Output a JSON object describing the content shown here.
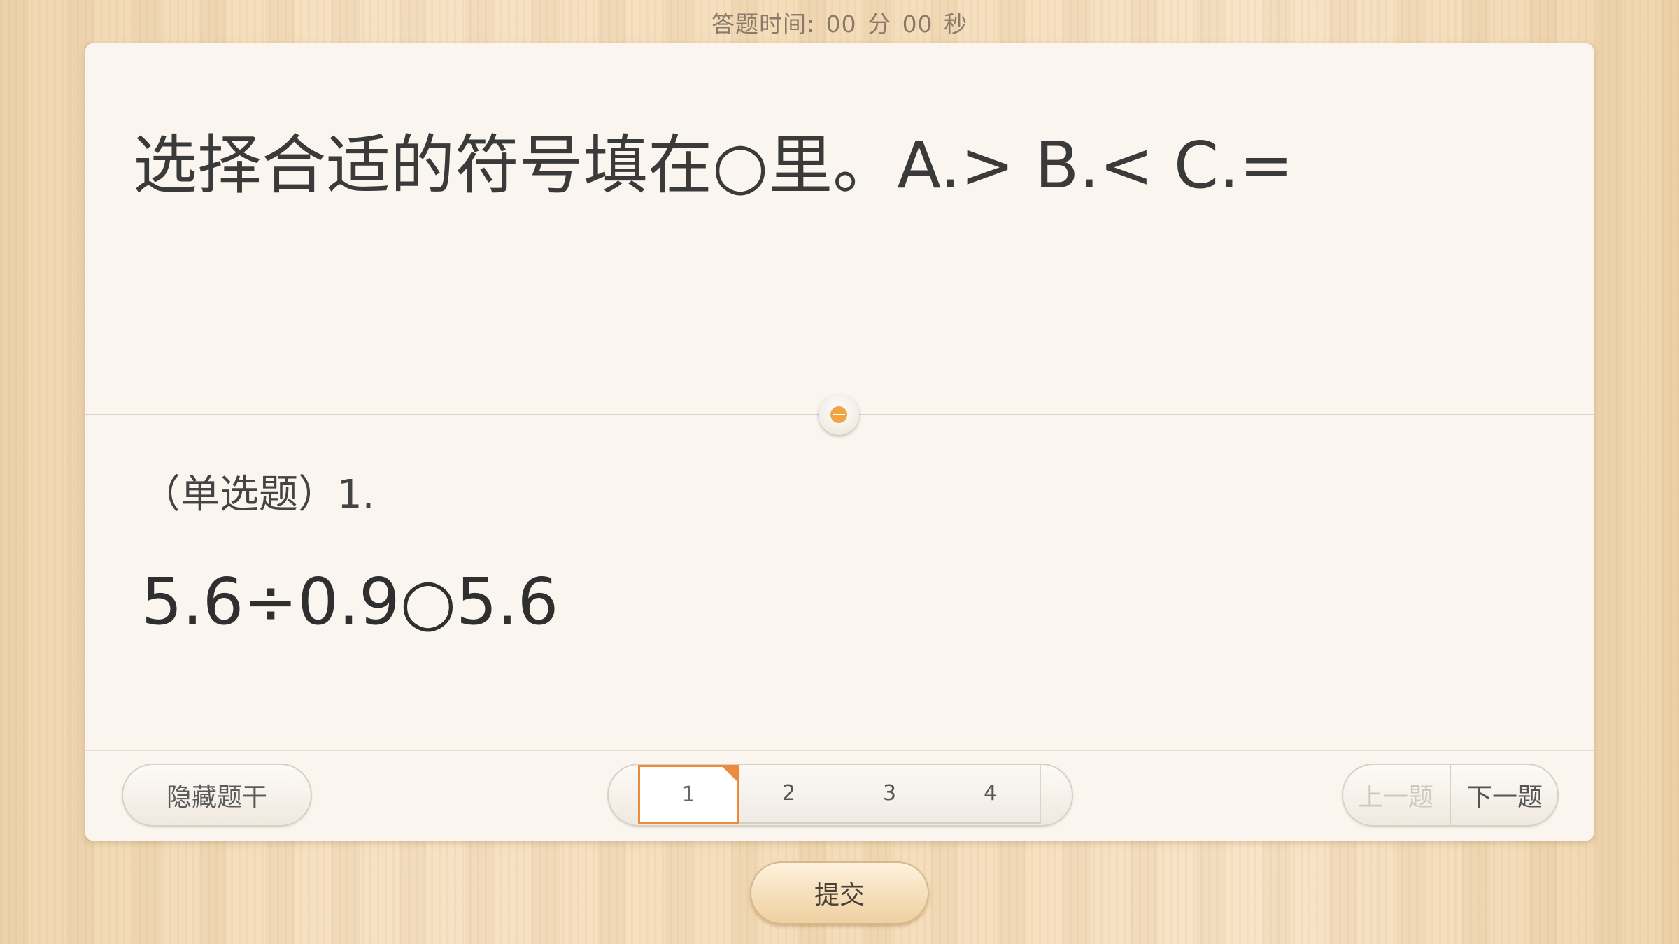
{
  "timer": {
    "label": "答题时间:",
    "minutes": "00",
    "minutes_unit": "分",
    "seconds": "00",
    "seconds_unit": "秒"
  },
  "question": {
    "stem": "选择合适的符号填在○里。A.>   B.<   C.=",
    "type_label": "（单选题）1.",
    "expression": "5.6÷0.9○5.6"
  },
  "footer": {
    "hide_label": "隐藏题干",
    "pages": [
      "1",
      "2",
      "3",
      "4"
    ],
    "active_page": "1",
    "prev_label": "上一题",
    "next_label": "下一题"
  },
  "submit_label": "提交",
  "colors": {
    "accent": "#ee8a3c",
    "card_bg": "#faf6ef",
    "text": "#3a3a3a"
  },
  "icons": {
    "divider_handle": "collapse-toggle-icon",
    "page_flag": "flag-corner-icon"
  }
}
